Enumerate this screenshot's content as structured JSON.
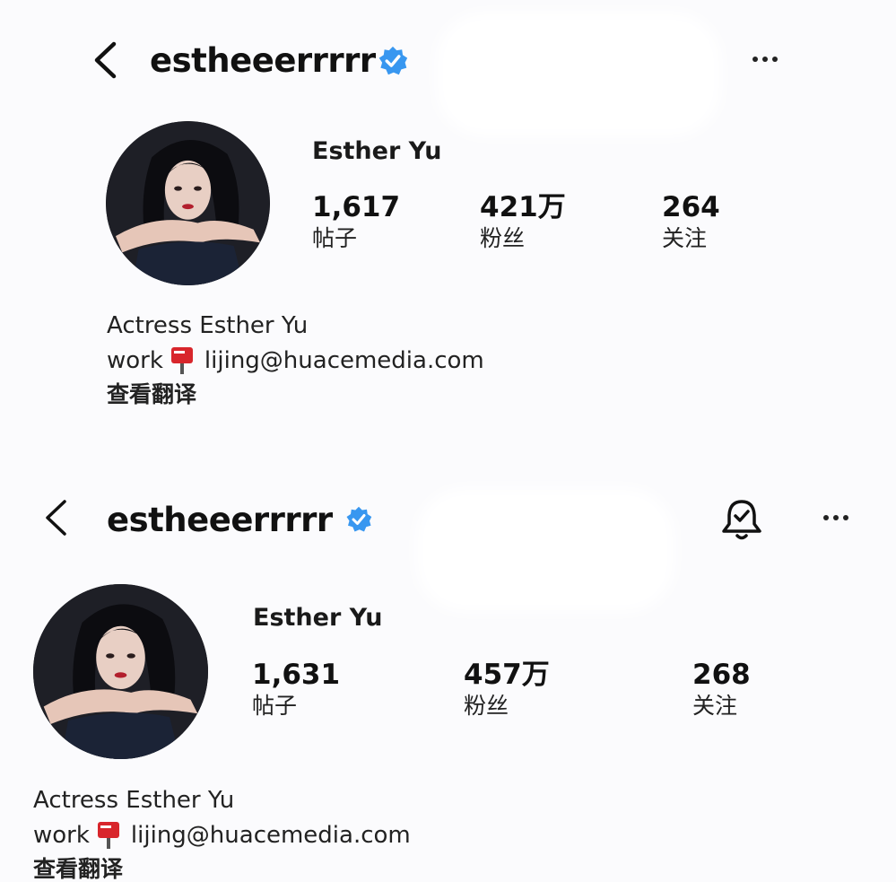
{
  "profiles": [
    {
      "username": "estheeerrrrr",
      "display_name": "Esther Yu",
      "stats": [
        {
          "value": "1,617",
          "label": "帖子"
        },
        {
          "value": "421万",
          "label": "粉丝"
        },
        {
          "value": "264",
          "label": "关注"
        }
      ],
      "bio": "Actress Esther Yu",
      "work_label": "work",
      "email": "lijing@huacemedia.com",
      "translate_label": "查看翻译"
    },
    {
      "username": "estheeerrrrr",
      "display_name": "Esther Yu",
      "stats": [
        {
          "value": "1,631",
          "label": "帖子"
        },
        {
          "value": "457万",
          "label": "粉丝"
        },
        {
          "value": "268",
          "label": "关注"
        }
      ],
      "bio": "Actress Esther Yu",
      "work_label": "work",
      "email": "lijing@huacemedia.com",
      "translate_label": "查看翻译"
    }
  ],
  "colors": {
    "verified_blue": "#3897f0",
    "mailbox_red": "#d8262c",
    "text": "#111111"
  },
  "icons": [
    "back-arrow-icon",
    "verified-badge-icon",
    "more-options-icon",
    "notification-bell-icon",
    "mailbox-icon"
  ]
}
